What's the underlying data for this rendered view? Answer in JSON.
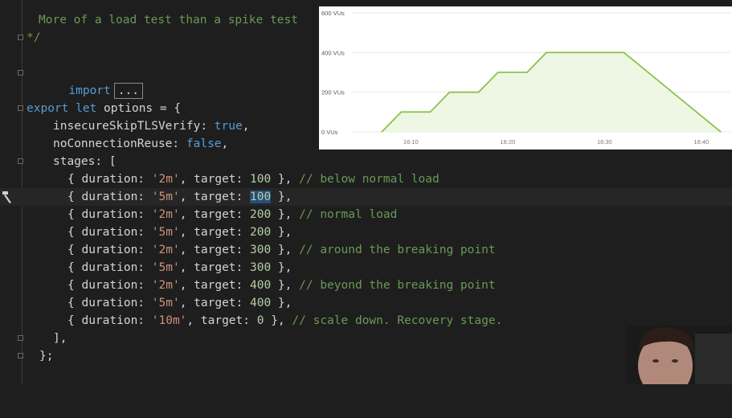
{
  "code": {
    "line1": "More of a load test than a spike test",
    "line2": "*/",
    "import_kw": "import",
    "import_collapsed": "...",
    "export_kw": "export",
    "let_kw": "let",
    "options_text": " options = {",
    "insecure_prop": "insecureSkipTLSVerify: ",
    "insecure_val": "true",
    "insecure_end": ",",
    "noconn_prop": "noConnectionReuse: ",
    "noconn_val": "false",
    "noconn_end": ",",
    "stages_open": "stages: [",
    "stages": [
      {
        "pre": "{ duration: ",
        "dur": "'2m'",
        "mid": ", target: ",
        "tgt": "100",
        "post": " },",
        "comment": " // below normal load"
      },
      {
        "pre": "{ duration: ",
        "dur": "'5m'",
        "mid": ", target: ",
        "tgt": "100",
        "post": " },",
        "comment": ""
      },
      {
        "pre": "{ duration: ",
        "dur": "'2m'",
        "mid": ", target: ",
        "tgt": "200",
        "post": " },",
        "comment": " // normal load"
      },
      {
        "pre": "{ duration: ",
        "dur": "'5m'",
        "mid": ", target: ",
        "tgt": "200",
        "post": " },",
        "comment": ""
      },
      {
        "pre": "{ duration: ",
        "dur": "'2m'",
        "mid": ", target: ",
        "tgt": "300",
        "post": " },",
        "comment": " // around the breaking point"
      },
      {
        "pre": "{ duration: ",
        "dur": "'5m'",
        "mid": ", target: ",
        "tgt": "300",
        "post": " },",
        "comment": ""
      },
      {
        "pre": "{ duration: ",
        "dur": "'2m'",
        "mid": ", target: ",
        "tgt": "400",
        "post": " },",
        "comment": " // beyond the breaking point"
      },
      {
        "pre": "{ duration: ",
        "dur": "'5m'",
        "mid": ", target: ",
        "tgt": "400",
        "post": " },",
        "comment": ""
      },
      {
        "pre": "{ duration: ",
        "dur": "'10m'",
        "mid": ", target: ",
        "tgt": "0",
        "post": " },",
        "comment": " // scale down. Recovery stage."
      }
    ],
    "stages_close": "],",
    "options_close": "};"
  },
  "chart_data": {
    "type": "area",
    "x_unit": "time",
    "x": [
      "16:07",
      "16:09",
      "16:12",
      "16:14",
      "16:17",
      "16:19",
      "16:22",
      "16:24",
      "16:27",
      "16:32",
      "16:42"
    ],
    "y": [
      0,
      100,
      100,
      200,
      200,
      300,
      300,
      400,
      400,
      400,
      0
    ],
    "y_ticks": [
      "0 VUs",
      "200 VUs",
      "400 VUs",
      "600 VUs"
    ],
    "x_ticks": [
      "16:10",
      "16:20",
      "16:30",
      "16:40"
    ],
    "ylim": [
      0,
      600
    ],
    "grid": true,
    "line_color": "#8bc34a",
    "fill_color": "#eef7e4"
  }
}
